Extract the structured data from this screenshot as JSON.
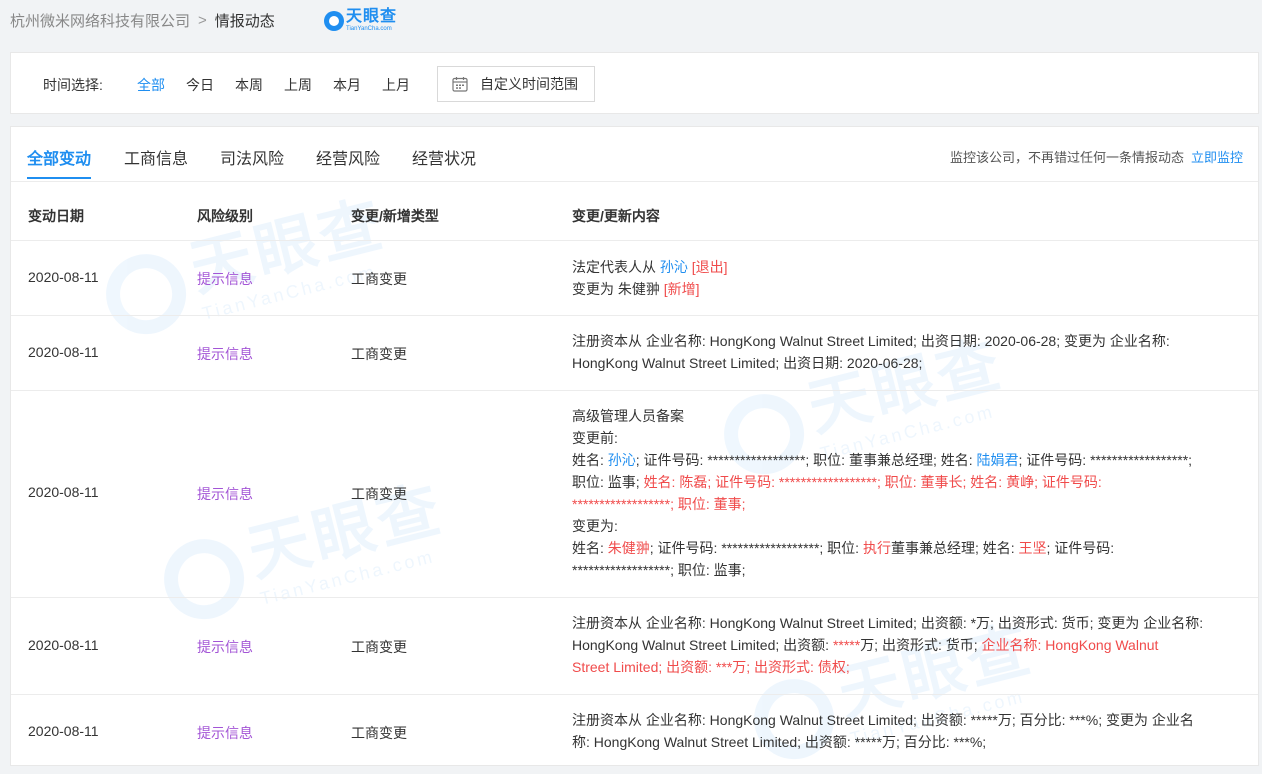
{
  "breadcrumb": {
    "company": "杭州微米网络科技有限公司",
    "separator": ">",
    "current": "情报动态"
  },
  "logo": {
    "cn": "天眼查",
    "en": "TianYanCha.com"
  },
  "filter": {
    "label": "时间选择:",
    "options": [
      "全部",
      "今日",
      "本周",
      "上周",
      "本月",
      "上月"
    ],
    "active": "全部",
    "custom_label": "自定义时间范围"
  },
  "tabs": [
    "全部变动",
    "工商信息",
    "司法风险",
    "经营风险",
    "经营状况"
  ],
  "monitor": {
    "text": "监控该公司，不再错过任何一条情报动态",
    "link": "立即监控"
  },
  "table": {
    "headers": [
      "变动日期",
      "风险级别",
      "变更/新增类型",
      "变更/更新内容"
    ],
    "rows": [
      {
        "date": "2020-08-11",
        "risk": "提示信息",
        "type": "工商变更",
        "l1a": "法定代表人从",
        "l1b": "孙沁",
        "l1c": "[退出]",
        "l2a": "变更为",
        "l2b": "朱健翀",
        "l2c": "[新增]"
      },
      {
        "date": "2020-08-11",
        "risk": "提示信息",
        "type": "工商变更",
        "l1": "注册资本从 企业名称: HongKong Walnut Street Limited; 出资日期: 2020-06-28; 变更为 企业名称:",
        "l2": "HongKong Walnut Street Limited; 出资日期: 2020-06-28;"
      },
      {
        "date": "2020-08-11",
        "risk": "提示信息",
        "type": "工商变更",
        "title": "高级管理人员备案",
        "before_label": "变更前:",
        "b1": "姓名: ",
        "b2": "孙沁",
        "b3": "; 证件号码: ******************; 职位: 董事兼总经理; 姓名: ",
        "b4": "陆娟君",
        "b5": "; 证件号码: ******************;",
        "b6": "职位: 监事; ",
        "b7": "姓名: 陈磊; 证件号码: ******************; 职位: 董事长; 姓名: 黄峥; 证件号码:",
        "b8": "******************; 职位: 董事;",
        "after_label": "变更为:",
        "a1": "姓名: ",
        "a2": "朱健翀",
        "a3": "; 证件号码: ******************; 职位: ",
        "a4": "执行",
        "a5": "董事兼总经理; 姓名: ",
        "a6": "王坚",
        "a7": "; 证件号码:",
        "a8": "******************; 职位: 监事;"
      },
      {
        "date": "2020-08-11",
        "risk": "提示信息",
        "type": "工商变更",
        "l1": "注册资本从 企业名称: HongKong Walnut Street Limited; 出资额: *万; 出资形式: 货币; 变更为 企业名称:",
        "l2a": "HongKong Walnut Street Limited; 出资额: ",
        "l2b": "*****",
        "l2c": "万; 出资形式: 货币; ",
        "l2d": "企业名称: HongKong Walnut",
        "l3": "Street Limited; 出资额: ***万; 出资形式: 债权;"
      },
      {
        "date": "2020-08-11",
        "risk": "提示信息",
        "type": "工商变更",
        "l1": "注册资本从 企业名称: HongKong Walnut Street Limited; 出资额: *****万; 百分比: ***%; 变更为 企业名",
        "l2": "称: HongKong Walnut Street Limited; 出资额: *****万; 百分比: ***%;"
      }
    ]
  },
  "colors": {
    "accent": "#1f8ef0",
    "risk": "#a355d6",
    "highlight": "#f04b4b"
  }
}
